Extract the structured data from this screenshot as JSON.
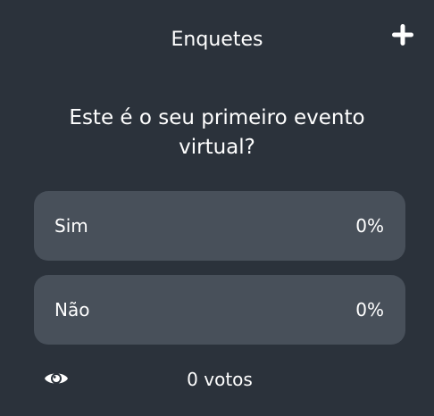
{
  "header": {
    "title": "Enquetes",
    "add_icon": "plus-icon"
  },
  "poll": {
    "question": "Este é o seu primeiro evento virtual?",
    "options": [
      {
        "label": "Sim",
        "percent": "0%"
      },
      {
        "label": "Não",
        "percent": "0%"
      }
    ]
  },
  "footer": {
    "visibility_icon": "eye-icon",
    "votes": "0 votos"
  },
  "colors": {
    "background": "#2b323b",
    "option_background": "#48505a",
    "text": "#ffffff"
  }
}
